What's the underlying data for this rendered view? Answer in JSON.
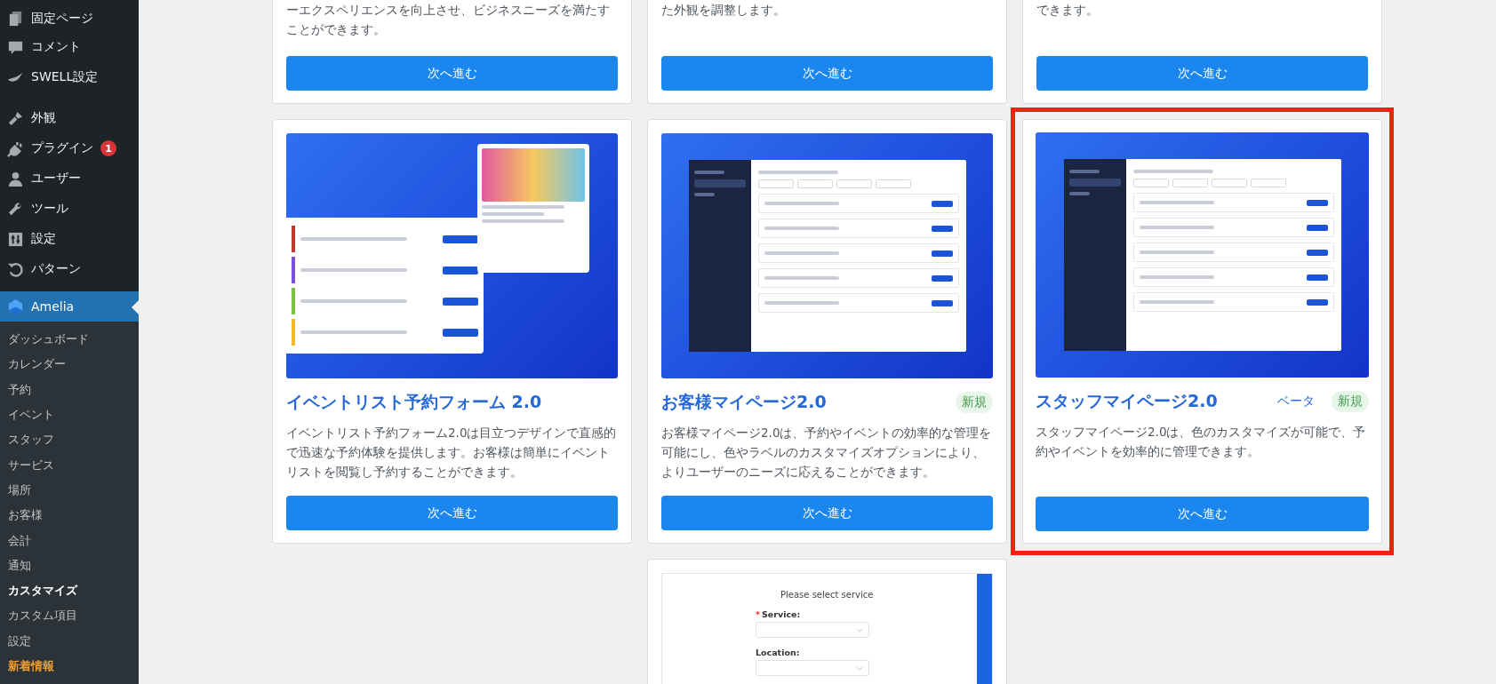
{
  "sidebar": {
    "menu": [
      {
        "label": "固定ページ",
        "selected": false
      },
      {
        "label": "コメント",
        "selected": false
      },
      {
        "label": "SWELL設定",
        "selected": false
      },
      {
        "label": "外観",
        "selected": false
      },
      {
        "label": "プラグイン",
        "selected": false,
        "badge": "1"
      },
      {
        "label": "ユーザー",
        "selected": false
      },
      {
        "label": "ツール",
        "selected": false
      },
      {
        "label": "設定",
        "selected": false
      },
      {
        "label": "パターン",
        "selected": false
      },
      {
        "label": "Amelia",
        "selected": true
      }
    ],
    "submenu": [
      {
        "label": "ダッシュボード",
        "kind": "link",
        "selected": false
      },
      {
        "label": "カレンダー",
        "kind": "link",
        "selected": false
      },
      {
        "label": "予約",
        "kind": "link",
        "selected": false
      },
      {
        "label": "イベント",
        "kind": "link",
        "selected": false
      },
      {
        "label": "スタッフ",
        "kind": "link",
        "selected": false
      },
      {
        "label": "サービス",
        "kind": "link",
        "selected": false
      },
      {
        "label": "場所",
        "kind": "link",
        "selected": false
      },
      {
        "label": "お客様",
        "kind": "link",
        "selected": false
      },
      {
        "label": "会計",
        "kind": "link",
        "selected": false
      },
      {
        "label": "通知",
        "kind": "link",
        "selected": false
      },
      {
        "label": "カスタマイズ",
        "kind": "link",
        "selected": true
      },
      {
        "label": "カスタム項目",
        "kind": "link",
        "selected": false
      },
      {
        "label": "設定",
        "kind": "link",
        "selected": false
      },
      {
        "label": "新着情報",
        "kind": "news",
        "selected": false
      }
    ]
  },
  "top_cards": [
    {
      "description": "ーエクスペリエンスを向上させ、ビジネスニーズを満たすことができます。",
      "button": "次へ進む"
    },
    {
      "description": "た外観を調整します。",
      "button": "次へ進む"
    },
    {
      "description": "できます。",
      "button": "次へ進む"
    }
  ],
  "cards": [
    {
      "title": "イベントリスト予約フォーム 2.0",
      "description": "イベントリスト予約フォーム2.0は目立つデザインで直感的で迅速な予約体験を提供します。お客様は簡単にイベントリストを閲覧し予約することができます。",
      "button": "次へ進む",
      "highlighted": false
    },
    {
      "title": "お客様マイページ2.0",
      "badges": [
        {
          "label": "新規",
          "kind": "new"
        }
      ],
      "description": "お客様マイページ2.0は、予約やイベントの効率的な管理を可能にし、色やラベルのカスタマイズオプションにより、よりユーザーのニーズに応えることができます。",
      "button": "次へ進む",
      "highlighted": false
    },
    {
      "title": "スタッフマイページ2.0",
      "badges": [
        {
          "label": "ベータ",
          "kind": "beta"
        },
        {
          "label": "新規",
          "kind": "new"
        }
      ],
      "description": "スタッフマイページ2.0は、色のカスタマイズが可能で、予約やイベントを効率的に管理できます。",
      "button": "次へ進む",
      "highlighted": true
    }
  ],
  "bottom_card": {
    "heading": "Please select service",
    "fields": [
      {
        "label": "Service:",
        "mark": "*"
      },
      {
        "label": "Location:"
      }
    ]
  }
}
